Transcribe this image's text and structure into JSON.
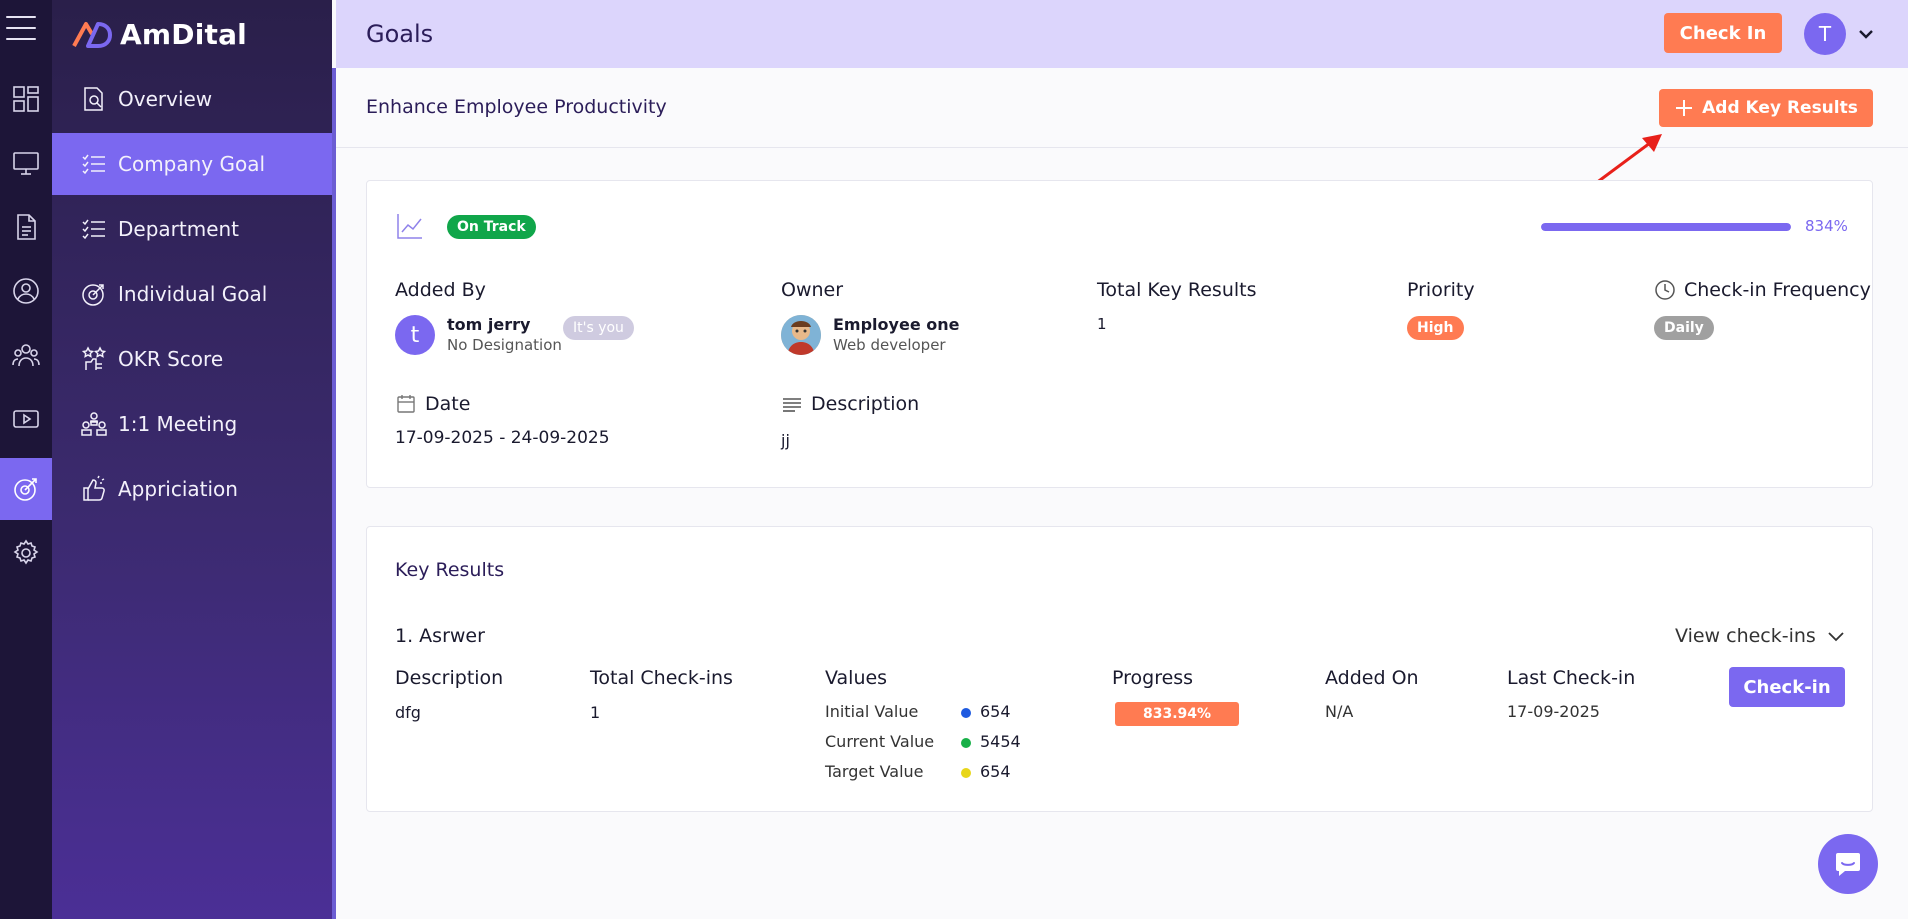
{
  "app": {
    "name": "AmDital"
  },
  "header": {
    "title": "Goals",
    "checkin_label": "Check In",
    "avatar_initial": "T"
  },
  "menu": {
    "items": [
      {
        "label": "Overview"
      },
      {
        "label": "Company Goal"
      },
      {
        "label": "Department"
      },
      {
        "label": "Individual Goal"
      },
      {
        "label": "OKR Score"
      },
      {
        "label": "1:1 Meeting"
      },
      {
        "label": "Appriciation"
      }
    ],
    "active_index": 1
  },
  "goal": {
    "title": "Enhance Employee Productivity",
    "add_key_results_label": "Add Key Results",
    "status": "On Track",
    "progress_percent": 834,
    "progress_label": "834%",
    "added_by": {
      "label": "Added By",
      "initial": "t",
      "name": "tom jerry",
      "designation": "No Designation",
      "badge": "It's you"
    },
    "owner": {
      "label": "Owner",
      "name": "Employee one",
      "designation": "Web developer"
    },
    "total_key_results": {
      "label": "Total Key Results",
      "value": "1"
    },
    "priority": {
      "label": "Priority",
      "value": "High"
    },
    "checkin_frequency": {
      "label": "Check-in Frequency",
      "value": "Daily"
    },
    "date": {
      "label": "Date",
      "value": "17-09-2025 - 24-09-2025"
    },
    "description": {
      "label": "Description",
      "value": "jj"
    }
  },
  "key_results": {
    "title": "Key Results",
    "view_checkins_label": "View check-ins",
    "items": [
      {
        "name": "1. Asrwer",
        "columns": {
          "description": "Description",
          "total_checkins": "Total Check-ins",
          "values": "Values",
          "progress": "Progress",
          "added_on": "Added On",
          "last_checkin": "Last Check-in"
        },
        "description": "dfg",
        "total_checkins": "1",
        "values": [
          {
            "label": "Initial Value",
            "value": "654",
            "color": "#1e5ae0"
          },
          {
            "label": "Current Value",
            "value": "5454",
            "color": "#18b048"
          },
          {
            "label": "Target Value",
            "value": "654",
            "color": "#e8d61a"
          }
        ],
        "progress_percent": 833.94,
        "progress_label": "833.94%",
        "added_on": "N/A",
        "last_checkin": "17-09-2025",
        "checkin_button": "Check-in"
      }
    ]
  },
  "colors": {
    "accent": "#7b68f0",
    "orange": "#ff7b52",
    "success": "#10a64a",
    "rail_bg": "#1d1538",
    "header_bg": "#dcd5fc"
  }
}
